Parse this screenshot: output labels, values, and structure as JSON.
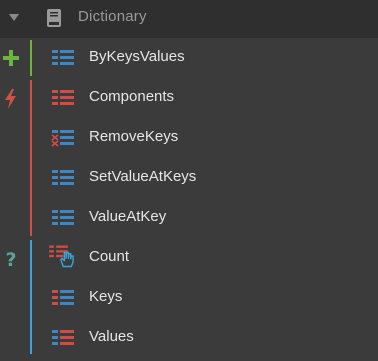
{
  "header": {
    "title": "Dictionary"
  },
  "groups": {
    "create": {
      "items": [
        "ByKeysValues"
      ]
    },
    "action": {
      "items": [
        "Components",
        "RemoveKeys",
        "SetValueAtKeys",
        "ValueAtKey"
      ]
    },
    "query": {
      "items": [
        "Count",
        "Keys",
        "Values"
      ]
    }
  },
  "colors": {
    "create": "#6cb33f",
    "action": "#cf5045",
    "query": "#3aa3d8",
    "node_blue": "#3f86c4",
    "node_red": "#d14c44"
  }
}
